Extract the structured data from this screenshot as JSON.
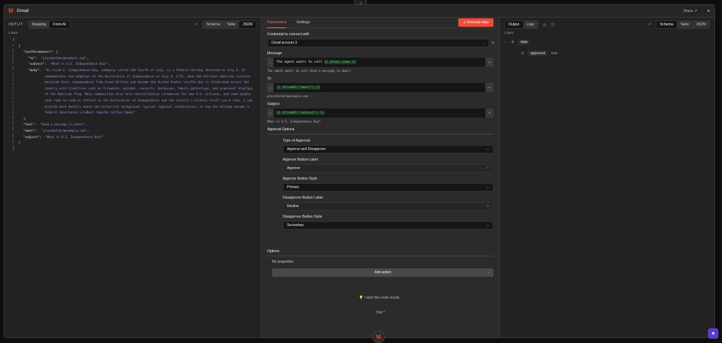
{
  "header": {
    "title": "Gmail",
    "docs": "Docs",
    "close": "×"
  },
  "input": {
    "label": "INPUT",
    "mode_tabs": [
      "Mapping",
      "From AI"
    ],
    "active_mode": "From AI",
    "view_tabs": [
      "Schema",
      "Table",
      "JSON"
    ],
    "active_view": "JSON",
    "count": "1 item",
    "json": {
      "to": "\"placeholder@example.com\"",
      "subject": "\"What is U.S. Independence Day?\"",
      "body": "\"Hi,\\n\\nU.S. Independence Day, commonly called the Fourth of July, is a federal holiday observed on July 4. It commemorates the adoption of the Declaration of Independence on July 4, 1776, when the thirteen American colonies declared their independence from Great Britain and became the United States.\\n\\nThe day is celebrated across the country with traditions such as fireworks, parades, concerts, barbecues, family gatherings, and prominent displays of the American flag. Many communities also hold naturalization ceremonies for new U.S. citizens, and some people take time to read or reflect on the Declaration of Independence and the country's history.\\n\\nIf you'd like, I can provide more details about the historical background, typical regional celebrations, or how the holiday became a federal observance.\\n\\nBest regards,\\n[Your Name]\"",
      "tool": "\"Send_a_message_in_Gmail\"",
      "email": "\"placeholder@example.com\"",
      "subject2": "\"What is U.S. Independence Day?\""
    }
  },
  "params": {
    "tabs": [
      "Parameters",
      "Settings"
    ],
    "execute": "Execute step",
    "credential_label": "Credential to connect with",
    "credential": "Gmail account 3",
    "message_label": "Message",
    "message_text": "The agent wants to call ",
    "message_expr": "{{ $tool.name }}",
    "message_hint": "The agent wants to call Send_a_message_in_Gmail",
    "to_label": "To",
    "to_expr": "{{ $fromAI(\"email\") }}",
    "to_hint": "placeholder@example.com",
    "subject_label": "Subject",
    "subject_expr": "{{ $fromAI(\"subject\") }}",
    "subject_hint": "What is U.S. Independence Day?",
    "approval_label": "Approval Options",
    "type_label": "Type of Approval",
    "type": "Approve and Disapprove",
    "approve_label_label": "Approve Button Label",
    "approve_label": "Approve",
    "approve_style_label": "Approve Button Style",
    "approve_style": "Primary",
    "disapprove_label_label": "Disapprove Button Label",
    "disapprove_label": "Decline",
    "disapprove_style_label": "Disapprove Button Style",
    "disapprove_style": "Secondary",
    "options_label": "Options",
    "no_props": "No properties",
    "add_option": "Add option",
    "wish": "I wish this node would...",
    "tool": "Tool *"
  },
  "output": {
    "tabs": [
      "Output",
      "Logs"
    ],
    "view_tabs": [
      "Schema",
      "Table",
      "JSON"
    ],
    "count": "1 item",
    "root": "data",
    "field": "approved",
    "value": "true"
  },
  "colors": {
    "accent": "#ff6d5a",
    "execute": "#f04b3c",
    "expr": "#5ad17a",
    "json_string": "#9b8fe0"
  }
}
